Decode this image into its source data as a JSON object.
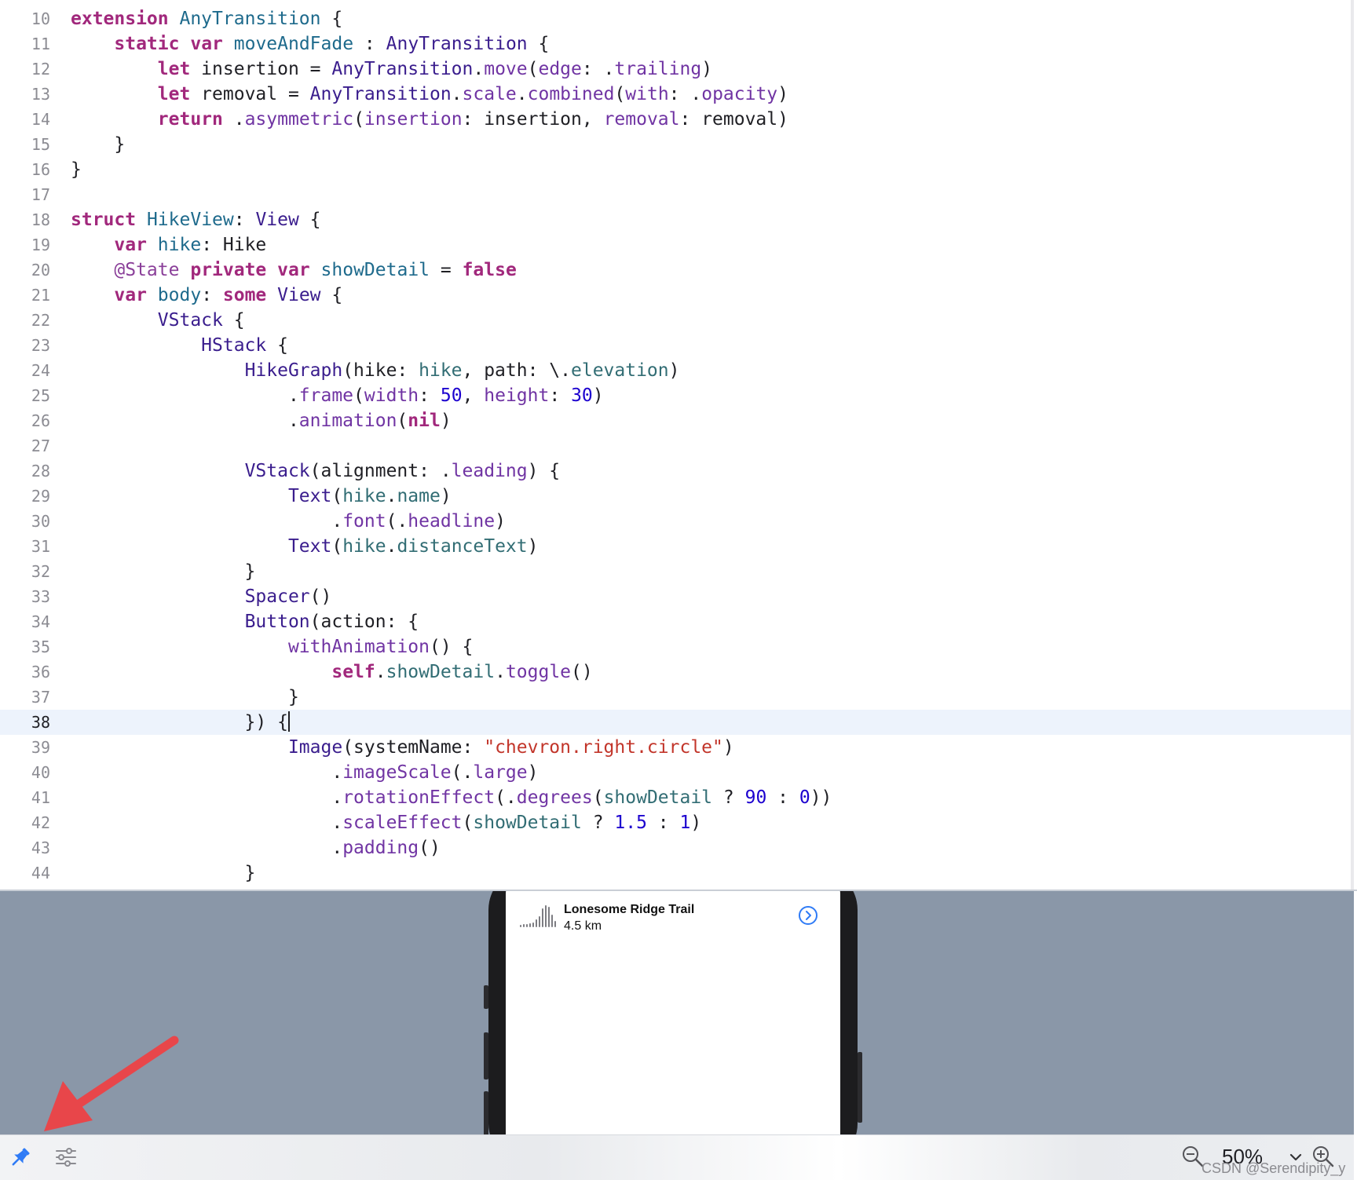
{
  "editor": {
    "current_line": "38",
    "lines": [
      {
        "n": "10",
        "tokens": [
          {
            "t": "extension",
            "c": "kw"
          },
          {
            "t": " ",
            "c": "plain"
          },
          {
            "t": "AnyTransition",
            "c": "decl"
          },
          {
            "t": " {",
            "c": "plain"
          }
        ]
      },
      {
        "n": "11",
        "tokens": [
          {
            "t": "    ",
            "c": "plain"
          },
          {
            "t": "static",
            "c": "kw"
          },
          {
            "t": " ",
            "c": "plain"
          },
          {
            "t": "var",
            "c": "kw"
          },
          {
            "t": " ",
            "c": "plain"
          },
          {
            "t": "moveAndFade",
            "c": "decl"
          },
          {
            "t": " : ",
            "c": "plain"
          },
          {
            "t": "AnyTransition",
            "c": "type"
          },
          {
            "t": " {",
            "c": "plain"
          }
        ]
      },
      {
        "n": "12",
        "tokens": [
          {
            "t": "        ",
            "c": "plain"
          },
          {
            "t": "let",
            "c": "kw"
          },
          {
            "t": " insertion = ",
            "c": "plain"
          },
          {
            "t": "AnyTransition",
            "c": "type"
          },
          {
            "t": ".",
            "c": "plain"
          },
          {
            "t": "move",
            "c": "member"
          },
          {
            "t": "(",
            "c": "plain"
          },
          {
            "t": "edge",
            "c": "member"
          },
          {
            "t": ": .",
            "c": "plain"
          },
          {
            "t": "trailing",
            "c": "member"
          },
          {
            "t": ")",
            "c": "plain"
          }
        ]
      },
      {
        "n": "13",
        "tokens": [
          {
            "t": "        ",
            "c": "plain"
          },
          {
            "t": "let",
            "c": "kw"
          },
          {
            "t": " removal = ",
            "c": "plain"
          },
          {
            "t": "AnyTransition",
            "c": "type"
          },
          {
            "t": ".",
            "c": "plain"
          },
          {
            "t": "scale",
            "c": "member"
          },
          {
            "t": ".",
            "c": "plain"
          },
          {
            "t": "combined",
            "c": "member"
          },
          {
            "t": "(",
            "c": "plain"
          },
          {
            "t": "with",
            "c": "member"
          },
          {
            "t": ": .",
            "c": "plain"
          },
          {
            "t": "opacity",
            "c": "member"
          },
          {
            "t": ")",
            "c": "plain"
          }
        ]
      },
      {
        "n": "14",
        "tokens": [
          {
            "t": "        ",
            "c": "plain"
          },
          {
            "t": "return",
            "c": "kw"
          },
          {
            "t": " .",
            "c": "plain"
          },
          {
            "t": "asymmetric",
            "c": "member"
          },
          {
            "t": "(",
            "c": "plain"
          },
          {
            "t": "insertion",
            "c": "member"
          },
          {
            "t": ": insertion, ",
            "c": "plain"
          },
          {
            "t": "removal",
            "c": "member"
          },
          {
            "t": ": removal)",
            "c": "plain"
          }
        ]
      },
      {
        "n": "15",
        "tokens": [
          {
            "t": "    }",
            "c": "plain"
          }
        ]
      },
      {
        "n": "16",
        "tokens": [
          {
            "t": "}",
            "c": "plain"
          }
        ]
      },
      {
        "n": "17",
        "tokens": []
      },
      {
        "n": "18",
        "tokens": [
          {
            "t": "struct",
            "c": "kw"
          },
          {
            "t": " ",
            "c": "plain"
          },
          {
            "t": "HikeView",
            "c": "decl"
          },
          {
            "t": ": ",
            "c": "plain"
          },
          {
            "t": "View",
            "c": "type"
          },
          {
            "t": " {",
            "c": "plain"
          }
        ]
      },
      {
        "n": "19",
        "tokens": [
          {
            "t": "    ",
            "c": "plain"
          },
          {
            "t": "var",
            "c": "kw"
          },
          {
            "t": " ",
            "c": "plain"
          },
          {
            "t": "hike",
            "c": "decl"
          },
          {
            "t": ": ",
            "c": "plain"
          },
          {
            "t": "Hike",
            "c": "plain"
          }
        ]
      },
      {
        "n": "20",
        "tokens": [
          {
            "t": "    ",
            "c": "plain"
          },
          {
            "t": "@State",
            "c": "attr"
          },
          {
            "t": " ",
            "c": "plain"
          },
          {
            "t": "private",
            "c": "kw"
          },
          {
            "t": " ",
            "c": "plain"
          },
          {
            "t": "var",
            "c": "kw"
          },
          {
            "t": " ",
            "c": "plain"
          },
          {
            "t": "showDetail",
            "c": "decl"
          },
          {
            "t": " = ",
            "c": "plain"
          },
          {
            "t": "false",
            "c": "kw"
          }
        ]
      },
      {
        "n": "21",
        "tokens": [
          {
            "t": "    ",
            "c": "plain"
          },
          {
            "t": "var",
            "c": "kw"
          },
          {
            "t": " ",
            "c": "plain"
          },
          {
            "t": "body",
            "c": "decl"
          },
          {
            "t": ": ",
            "c": "plain"
          },
          {
            "t": "some",
            "c": "kw"
          },
          {
            "t": " ",
            "c": "plain"
          },
          {
            "t": "View",
            "c": "type"
          },
          {
            "t": " {",
            "c": "plain"
          }
        ]
      },
      {
        "n": "22",
        "tokens": [
          {
            "t": "        ",
            "c": "plain"
          },
          {
            "t": "VStack",
            "c": "type"
          },
          {
            "t": " {",
            "c": "plain"
          }
        ]
      },
      {
        "n": "23",
        "tokens": [
          {
            "t": "            ",
            "c": "plain"
          },
          {
            "t": "HStack",
            "c": "type"
          },
          {
            "t": " {",
            "c": "plain"
          }
        ]
      },
      {
        "n": "24",
        "tokens": [
          {
            "t": "                ",
            "c": "plain"
          },
          {
            "t": "HikeGraph",
            "c": "type"
          },
          {
            "t": "(hike: ",
            "c": "plain"
          },
          {
            "t": "hike",
            "c": "local"
          },
          {
            "t": ", path: \\.",
            "c": "plain"
          },
          {
            "t": "elevation",
            "c": "local"
          },
          {
            "t": ")",
            "c": "plain"
          }
        ]
      },
      {
        "n": "25",
        "tokens": [
          {
            "t": "                    .",
            "c": "plain"
          },
          {
            "t": "frame",
            "c": "member"
          },
          {
            "t": "(",
            "c": "plain"
          },
          {
            "t": "width",
            "c": "member"
          },
          {
            "t": ": ",
            "c": "plain"
          },
          {
            "t": "50",
            "c": "num"
          },
          {
            "t": ", ",
            "c": "plain"
          },
          {
            "t": "height",
            "c": "member"
          },
          {
            "t": ": ",
            "c": "plain"
          },
          {
            "t": "30",
            "c": "num"
          },
          {
            "t": ")",
            "c": "plain"
          }
        ]
      },
      {
        "n": "26",
        "tokens": [
          {
            "t": "                    .",
            "c": "plain"
          },
          {
            "t": "animation",
            "c": "member"
          },
          {
            "t": "(",
            "c": "plain"
          },
          {
            "t": "nil",
            "c": "kw"
          },
          {
            "t": ")",
            "c": "plain"
          }
        ]
      },
      {
        "n": "27",
        "tokens": []
      },
      {
        "n": "28",
        "tokens": [
          {
            "t": "                ",
            "c": "plain"
          },
          {
            "t": "VStack",
            "c": "type"
          },
          {
            "t": "(alignment: .",
            "c": "plain"
          },
          {
            "t": "leading",
            "c": "member"
          },
          {
            "t": ") {",
            "c": "plain"
          }
        ]
      },
      {
        "n": "29",
        "tokens": [
          {
            "t": "                    ",
            "c": "plain"
          },
          {
            "t": "Text",
            "c": "type"
          },
          {
            "t": "(",
            "c": "plain"
          },
          {
            "t": "hike",
            "c": "local"
          },
          {
            "t": ".",
            "c": "plain"
          },
          {
            "t": "name",
            "c": "local"
          },
          {
            "t": ")",
            "c": "plain"
          }
        ]
      },
      {
        "n": "30",
        "tokens": [
          {
            "t": "                        .",
            "c": "plain"
          },
          {
            "t": "font",
            "c": "member"
          },
          {
            "t": "(.",
            "c": "plain"
          },
          {
            "t": "headline",
            "c": "member"
          },
          {
            "t": ")",
            "c": "plain"
          }
        ]
      },
      {
        "n": "31",
        "tokens": [
          {
            "t": "                    ",
            "c": "plain"
          },
          {
            "t": "Text",
            "c": "type"
          },
          {
            "t": "(",
            "c": "plain"
          },
          {
            "t": "hike",
            "c": "local"
          },
          {
            "t": ".",
            "c": "plain"
          },
          {
            "t": "distanceText",
            "c": "local"
          },
          {
            "t": ")",
            "c": "plain"
          }
        ]
      },
      {
        "n": "32",
        "tokens": [
          {
            "t": "                }",
            "c": "plain"
          }
        ]
      },
      {
        "n": "33",
        "tokens": [
          {
            "t": "                ",
            "c": "plain"
          },
          {
            "t": "Spacer",
            "c": "type"
          },
          {
            "t": "()",
            "c": "plain"
          }
        ]
      },
      {
        "n": "34",
        "tokens": [
          {
            "t": "                ",
            "c": "plain"
          },
          {
            "t": "Button",
            "c": "type"
          },
          {
            "t": "(action: {",
            "c": "plain"
          }
        ]
      },
      {
        "n": "35",
        "tokens": [
          {
            "t": "                    ",
            "c": "plain"
          },
          {
            "t": "withAnimation",
            "c": "member"
          },
          {
            "t": "() {",
            "c": "plain"
          }
        ]
      },
      {
        "n": "36",
        "tokens": [
          {
            "t": "                        ",
            "c": "plain"
          },
          {
            "t": "self",
            "c": "kw"
          },
          {
            "t": ".",
            "c": "plain"
          },
          {
            "t": "showDetail",
            "c": "local"
          },
          {
            "t": ".",
            "c": "plain"
          },
          {
            "t": "toggle",
            "c": "member"
          },
          {
            "t": "()",
            "c": "plain"
          }
        ]
      },
      {
        "n": "37",
        "tokens": [
          {
            "t": "                    }",
            "c": "plain"
          }
        ]
      },
      {
        "n": "38",
        "tokens": [
          {
            "t": "                }) {",
            "c": "plain"
          }
        ]
      },
      {
        "n": "39",
        "tokens": [
          {
            "t": "                    ",
            "c": "plain"
          },
          {
            "t": "Image",
            "c": "type"
          },
          {
            "t": "(systemName: ",
            "c": "plain"
          },
          {
            "t": "\"chevron.right.circle\"",
            "c": "str"
          },
          {
            "t": ")",
            "c": "plain"
          }
        ]
      },
      {
        "n": "40",
        "tokens": [
          {
            "t": "                        .",
            "c": "plain"
          },
          {
            "t": "imageScale",
            "c": "member"
          },
          {
            "t": "(.",
            "c": "plain"
          },
          {
            "t": "large",
            "c": "member"
          },
          {
            "t": ")",
            "c": "plain"
          }
        ]
      },
      {
        "n": "41",
        "tokens": [
          {
            "t": "                        .",
            "c": "plain"
          },
          {
            "t": "rotationEffect",
            "c": "member"
          },
          {
            "t": "(.",
            "c": "plain"
          },
          {
            "t": "degrees",
            "c": "member"
          },
          {
            "t": "(",
            "c": "plain"
          },
          {
            "t": "showDetail",
            "c": "local"
          },
          {
            "t": " ? ",
            "c": "plain"
          },
          {
            "t": "90",
            "c": "num"
          },
          {
            "t": " : ",
            "c": "plain"
          },
          {
            "t": "0",
            "c": "num"
          },
          {
            "t": "))",
            "c": "plain"
          }
        ]
      },
      {
        "n": "42",
        "tokens": [
          {
            "t": "                        .",
            "c": "plain"
          },
          {
            "t": "scaleEffect",
            "c": "member"
          },
          {
            "t": "(",
            "c": "plain"
          },
          {
            "t": "showDetail",
            "c": "local"
          },
          {
            "t": " ? ",
            "c": "plain"
          },
          {
            "t": "1.5",
            "c": "num"
          },
          {
            "t": " : ",
            "c": "plain"
          },
          {
            "t": "1",
            "c": "num"
          },
          {
            "t": ")",
            "c": "plain"
          }
        ]
      },
      {
        "n": "43",
        "tokens": [
          {
            "t": "                        .",
            "c": "plain"
          },
          {
            "t": "padding",
            "c": "member"
          },
          {
            "t": "()",
            "c": "plain"
          }
        ]
      },
      {
        "n": "44",
        "tokens": [
          {
            "t": "                }",
            "c": "plain"
          }
        ]
      }
    ]
  },
  "preview": {
    "hike_name": "Lonesome Ridge Trail",
    "hike_distance": "4.5 km",
    "accent_color": "#2f7bf6",
    "chevron_icon": "chevron-right-circle-icon",
    "graph_icon": "hike-graph-icon"
  },
  "annotation": {
    "arrow_color": "#e8464a"
  },
  "bottom_bar": {
    "pin_icon": "pin-icon",
    "settings_icon": "sliders-icon",
    "zoom_out_icon": "zoom-out-icon",
    "zoom_level": "50%",
    "zoom_dropdown_icon": "chevron-down-icon",
    "zoom_in_icon": "zoom-in-icon"
  },
  "watermark": "CSDN @Serendipity_y"
}
